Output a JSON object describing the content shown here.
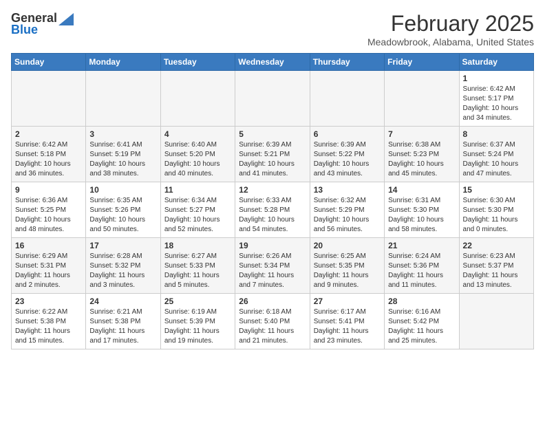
{
  "header": {
    "logo_general": "General",
    "logo_blue": "Blue",
    "title": "February 2025",
    "location": "Meadowbrook, Alabama, United States"
  },
  "weekdays": [
    "Sunday",
    "Monday",
    "Tuesday",
    "Wednesday",
    "Thursday",
    "Friday",
    "Saturday"
  ],
  "weeks": [
    [
      {
        "day": "",
        "info": ""
      },
      {
        "day": "",
        "info": ""
      },
      {
        "day": "",
        "info": ""
      },
      {
        "day": "",
        "info": ""
      },
      {
        "day": "",
        "info": ""
      },
      {
        "day": "",
        "info": ""
      },
      {
        "day": "1",
        "info": "Sunrise: 6:42 AM\nSunset: 5:17 PM\nDaylight: 10 hours\nand 34 minutes."
      }
    ],
    [
      {
        "day": "2",
        "info": "Sunrise: 6:42 AM\nSunset: 5:18 PM\nDaylight: 10 hours\nand 36 minutes."
      },
      {
        "day": "3",
        "info": "Sunrise: 6:41 AM\nSunset: 5:19 PM\nDaylight: 10 hours\nand 38 minutes."
      },
      {
        "day": "4",
        "info": "Sunrise: 6:40 AM\nSunset: 5:20 PM\nDaylight: 10 hours\nand 40 minutes."
      },
      {
        "day": "5",
        "info": "Sunrise: 6:39 AM\nSunset: 5:21 PM\nDaylight: 10 hours\nand 41 minutes."
      },
      {
        "day": "6",
        "info": "Sunrise: 6:39 AM\nSunset: 5:22 PM\nDaylight: 10 hours\nand 43 minutes."
      },
      {
        "day": "7",
        "info": "Sunrise: 6:38 AM\nSunset: 5:23 PM\nDaylight: 10 hours\nand 45 minutes."
      },
      {
        "day": "8",
        "info": "Sunrise: 6:37 AM\nSunset: 5:24 PM\nDaylight: 10 hours\nand 47 minutes."
      }
    ],
    [
      {
        "day": "9",
        "info": "Sunrise: 6:36 AM\nSunset: 5:25 PM\nDaylight: 10 hours\nand 48 minutes."
      },
      {
        "day": "10",
        "info": "Sunrise: 6:35 AM\nSunset: 5:26 PM\nDaylight: 10 hours\nand 50 minutes."
      },
      {
        "day": "11",
        "info": "Sunrise: 6:34 AM\nSunset: 5:27 PM\nDaylight: 10 hours\nand 52 minutes."
      },
      {
        "day": "12",
        "info": "Sunrise: 6:33 AM\nSunset: 5:28 PM\nDaylight: 10 hours\nand 54 minutes."
      },
      {
        "day": "13",
        "info": "Sunrise: 6:32 AM\nSunset: 5:29 PM\nDaylight: 10 hours\nand 56 minutes."
      },
      {
        "day": "14",
        "info": "Sunrise: 6:31 AM\nSunset: 5:30 PM\nDaylight: 10 hours\nand 58 minutes."
      },
      {
        "day": "15",
        "info": "Sunrise: 6:30 AM\nSunset: 5:30 PM\nDaylight: 11 hours\nand 0 minutes."
      }
    ],
    [
      {
        "day": "16",
        "info": "Sunrise: 6:29 AM\nSunset: 5:31 PM\nDaylight: 11 hours\nand 2 minutes."
      },
      {
        "day": "17",
        "info": "Sunrise: 6:28 AM\nSunset: 5:32 PM\nDaylight: 11 hours\nand 3 minutes."
      },
      {
        "day": "18",
        "info": "Sunrise: 6:27 AM\nSunset: 5:33 PM\nDaylight: 11 hours\nand 5 minutes."
      },
      {
        "day": "19",
        "info": "Sunrise: 6:26 AM\nSunset: 5:34 PM\nDaylight: 11 hours\nand 7 minutes."
      },
      {
        "day": "20",
        "info": "Sunrise: 6:25 AM\nSunset: 5:35 PM\nDaylight: 11 hours\nand 9 minutes."
      },
      {
        "day": "21",
        "info": "Sunrise: 6:24 AM\nSunset: 5:36 PM\nDaylight: 11 hours\nand 11 minutes."
      },
      {
        "day": "22",
        "info": "Sunrise: 6:23 AM\nSunset: 5:37 PM\nDaylight: 11 hours\nand 13 minutes."
      }
    ],
    [
      {
        "day": "23",
        "info": "Sunrise: 6:22 AM\nSunset: 5:38 PM\nDaylight: 11 hours\nand 15 minutes."
      },
      {
        "day": "24",
        "info": "Sunrise: 6:21 AM\nSunset: 5:38 PM\nDaylight: 11 hours\nand 17 minutes."
      },
      {
        "day": "25",
        "info": "Sunrise: 6:19 AM\nSunset: 5:39 PM\nDaylight: 11 hours\nand 19 minutes."
      },
      {
        "day": "26",
        "info": "Sunrise: 6:18 AM\nSunset: 5:40 PM\nDaylight: 11 hours\nand 21 minutes."
      },
      {
        "day": "27",
        "info": "Sunrise: 6:17 AM\nSunset: 5:41 PM\nDaylight: 11 hours\nand 23 minutes."
      },
      {
        "day": "28",
        "info": "Sunrise: 6:16 AM\nSunset: 5:42 PM\nDaylight: 11 hours\nand 25 minutes."
      },
      {
        "day": "",
        "info": ""
      }
    ]
  ]
}
